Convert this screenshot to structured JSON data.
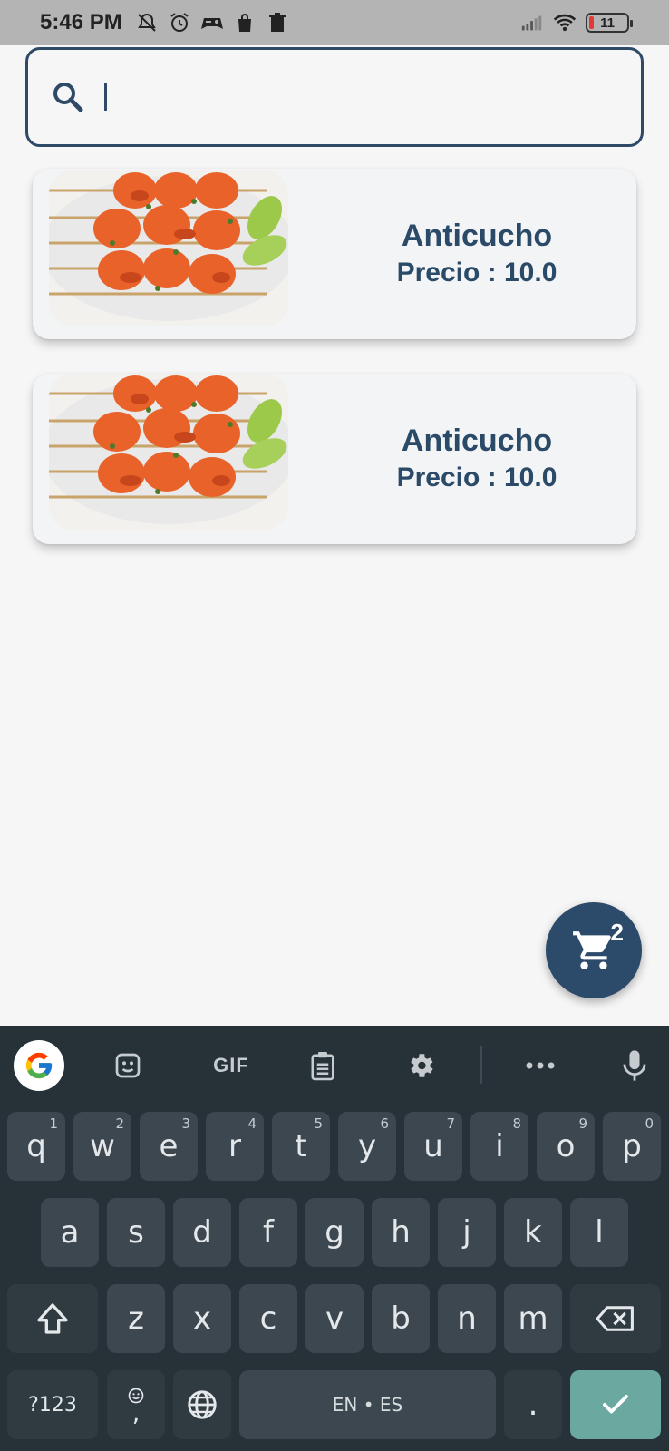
{
  "status_bar": {
    "time": "5:46 PM",
    "battery": "11",
    "left_icons": [
      "mute-icon",
      "alarm-icon",
      "game-icon",
      "bag-icon",
      "trash-icon"
    ],
    "right_icons": [
      "signal-icon",
      "wifi-icon",
      "battery-icon"
    ]
  },
  "search": {
    "placeholder": "",
    "value": ""
  },
  "products": [
    {
      "name": "Anticucho",
      "price": "Precio : 10.0"
    },
    {
      "name": "Anticucho",
      "price": "Precio : 10.0"
    }
  ],
  "cart": {
    "count": "2"
  },
  "keyboard": {
    "toolbar": {
      "gif": "GIF"
    },
    "row1": [
      {
        "key": "q",
        "hint": "1"
      },
      {
        "key": "w",
        "hint": "2"
      },
      {
        "key": "e",
        "hint": "3"
      },
      {
        "key": "r",
        "hint": "4"
      },
      {
        "key": "t",
        "hint": "5"
      },
      {
        "key": "y",
        "hint": "6"
      },
      {
        "key": "u",
        "hint": "7"
      },
      {
        "key": "i",
        "hint": "8"
      },
      {
        "key": "o",
        "hint": "9"
      },
      {
        "key": "p",
        "hint": "0"
      }
    ],
    "row2": [
      "a",
      "s",
      "d",
      "f",
      "g",
      "h",
      "j",
      "k",
      "l"
    ],
    "row3": [
      "z",
      "x",
      "c",
      "v",
      "b",
      "n",
      "m"
    ],
    "symbols_label": "?123",
    "comma": ",",
    "space_label": "EN • ES",
    "period": "."
  },
  "colors": {
    "primary": "#2c4a69",
    "keyboard_bg": "#263238",
    "key_bg": "#3c474f",
    "enter_key": "#6aa8a0"
  }
}
